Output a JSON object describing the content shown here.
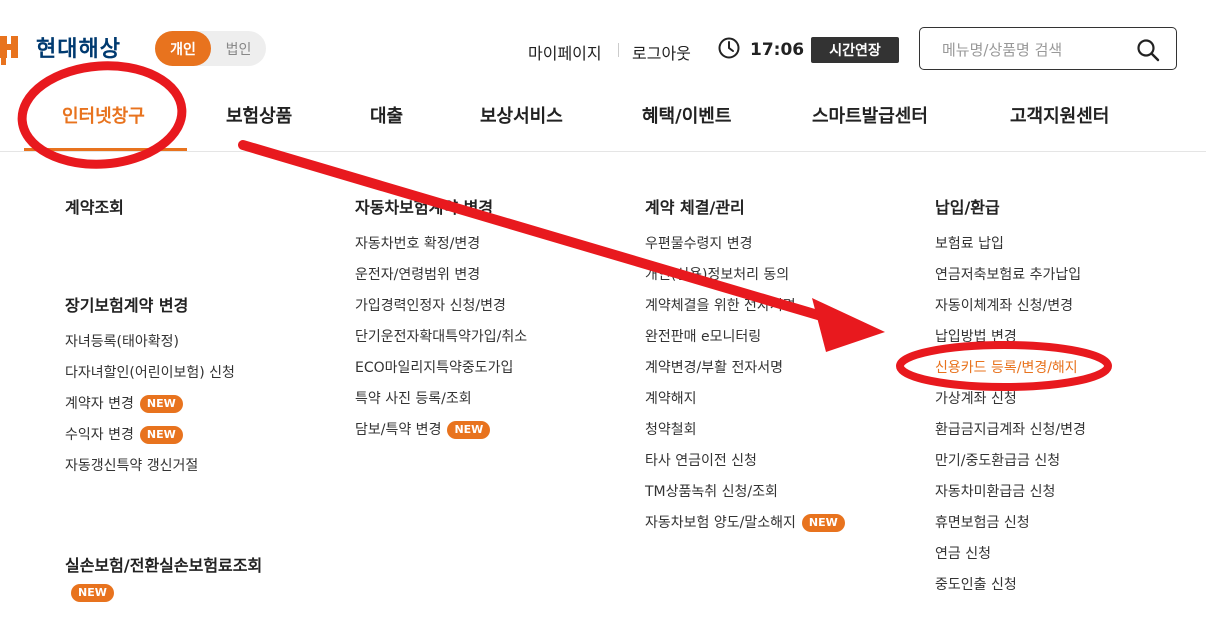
{
  "header": {
    "logo_text": "현대해상",
    "toggle": {
      "personal": "개인",
      "corporate": "법인"
    },
    "mypage": "마이페이지",
    "logout": "로그아웃",
    "time": "17:06",
    "extend_label": "시간연장",
    "search_placeholder": "메뉴명/상품명 검색"
  },
  "gnb": [
    "인터넷창구",
    "보험상품",
    "대출",
    "보상서비스",
    "혜택/이벤트",
    "스마트발급센터",
    "고객지원센터"
  ],
  "menu": {
    "col1": {
      "cat1": "계약조회",
      "cat2": "장기보험계약 변경",
      "cat2_items": [
        "자녀등록(태아확정)",
        "다자녀할인(어린이보험) 신청",
        "계약자 변경",
        "수익자 변경",
        "자동갱신특약 갱신거절"
      ],
      "cat3": "실손보험/전환실손보험료조회"
    },
    "col2": {
      "cat": "자동차보험계약 변경",
      "items": [
        "자동차번호 확정/변경",
        "운전자/연령범위 변경",
        "가입경력인정자 신청/변경",
        "단기운전자확대특약가입/취소",
        "ECO마일리지특약중도가입",
        "특약 사진 등록/조회",
        "담보/특약 변경"
      ]
    },
    "col3": {
      "cat": "계약 체결/관리",
      "items": [
        "우편물수령지 변경",
        "개인(신용)정보처리 동의",
        "계약체결을 위한 전자서명",
        "완전판매 e모니터링",
        "계약변경/부활 전자서명",
        "계약해지",
        "청약철회",
        "타사 연금이전 신청",
        "TM상품녹취 신청/조회",
        "자동차보험 양도/말소해지"
      ]
    },
    "col4": {
      "cat": "납입/환급",
      "items": [
        "보험료 납입",
        "연금저축보험료 추가납입",
        "자동이체계좌 신청/변경",
        "납입방법 변경",
        "신용카드 등록/변경/해지",
        "가상계좌 신청",
        "환급금지급계좌 신청/변경",
        "만기/중도환급금 신청",
        "자동차미환급금 신청",
        "휴면보험금 신청",
        "연금 신청",
        "중도인출 신청"
      ]
    },
    "new_badge": "NEW"
  },
  "colors": {
    "accent": "#e8731e",
    "annotation": "#e8191e",
    "brand_text": "#003a70"
  }
}
